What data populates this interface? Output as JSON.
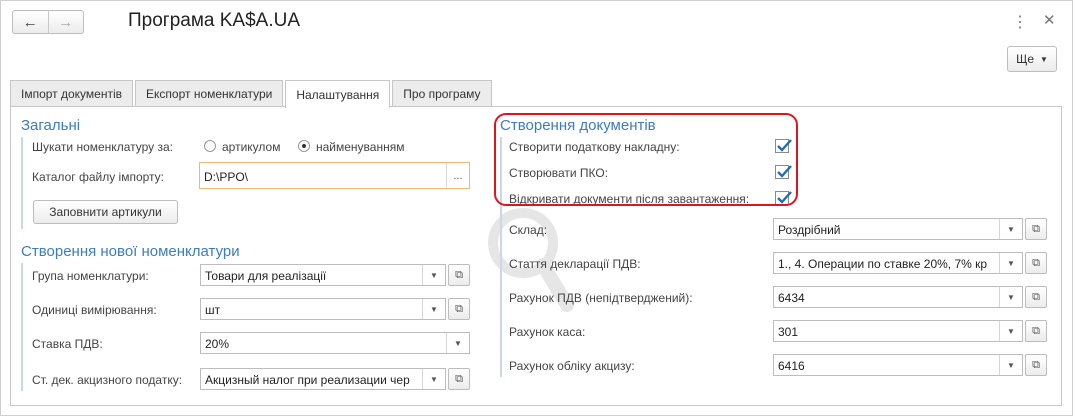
{
  "window": {
    "title": "Програма KA$A.UA",
    "back_icon": "arrow-left-icon",
    "forward_icon": "arrow-right-icon",
    "more_menu_icon": "vertical-dots-icon",
    "close_icon": "close-icon",
    "more_button_label": "Ще"
  },
  "tabs": [
    {
      "label": "Імпорт документів",
      "active": false
    },
    {
      "label": "Експорт номенклатури",
      "active": false
    },
    {
      "label": "Налаштування",
      "active": true
    },
    {
      "label": "Про програму",
      "active": false
    }
  ],
  "general": {
    "title": "Загальні",
    "search_by_label": "Шукати номенклатуру за:",
    "radio_article": "артикулом",
    "radio_name": "найменуванням",
    "selected": "найменуванням",
    "catalog_label": "Каталог файлу імпорту:",
    "catalog_value": "D:\\PPO\\",
    "catalog_button": "...",
    "fill_articles_button": "Заповнити артикули"
  },
  "new_nomenclature": {
    "title": "Створення нової номенклатури",
    "group_label": "Група номенклатури:",
    "group_value": "Товари для реалізації",
    "units_label": "Одиниці вимірювання:",
    "units_value": "шт",
    "vat_rate_label": "Ставка ПДВ:",
    "vat_rate_value": "20%",
    "excise_label": "Ст. дек. акцизного податку:",
    "excise_value": "Акцизный налог при реализации чер"
  },
  "documents": {
    "title": "Створення документів",
    "create_tax_invoice_label": "Створити податкову накладну:",
    "create_tax_invoice": true,
    "create_pko_label": "Створювати ПКО:",
    "create_pko": true,
    "open_after_load_label": "Відкривати документи після завантаження:",
    "open_after_load": true,
    "warehouse_label": "Склад:",
    "warehouse_value": "Роздрібний",
    "vat_decl_label": "Стаття декларації ПДВ:",
    "vat_decl_value": "1., 4. Операции по ставке 20%, 7% кр",
    "vat_account_label": "Рахунок ПДВ (непідтверджений):",
    "vat_account_value": "6434",
    "cash_account_label": "Рахунок каса:",
    "cash_account_value": "301",
    "excise_account_label": "Рахунок обліку акцизу:",
    "excise_account_value": "6416"
  },
  "colors": {
    "section_title": "#3d7cbf",
    "highlight": "#e0141e",
    "check": "#1f6fb8"
  }
}
